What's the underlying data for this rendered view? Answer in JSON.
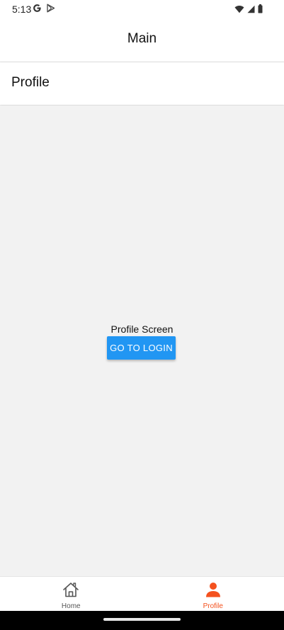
{
  "status_bar": {
    "time": "5:13",
    "left_icons": [
      "google-icon",
      "play-store-icon"
    ],
    "right_icons": [
      "wifi-icon",
      "signal-icon",
      "battery-icon"
    ]
  },
  "app_header": {
    "title": "Main"
  },
  "screen_header": {
    "title": "Profile"
  },
  "content": {
    "text": "Profile Screen",
    "button_label": "GO TO LOGIN"
  },
  "tab_bar": {
    "tabs": [
      {
        "label": "Home",
        "icon": "home-icon",
        "active": false
      },
      {
        "label": "Profile",
        "icon": "profile-icon",
        "active": true
      }
    ]
  },
  "colors": {
    "accent": "#2196f3",
    "active_tab": "#f4511e",
    "background": "#f2f2f2"
  }
}
